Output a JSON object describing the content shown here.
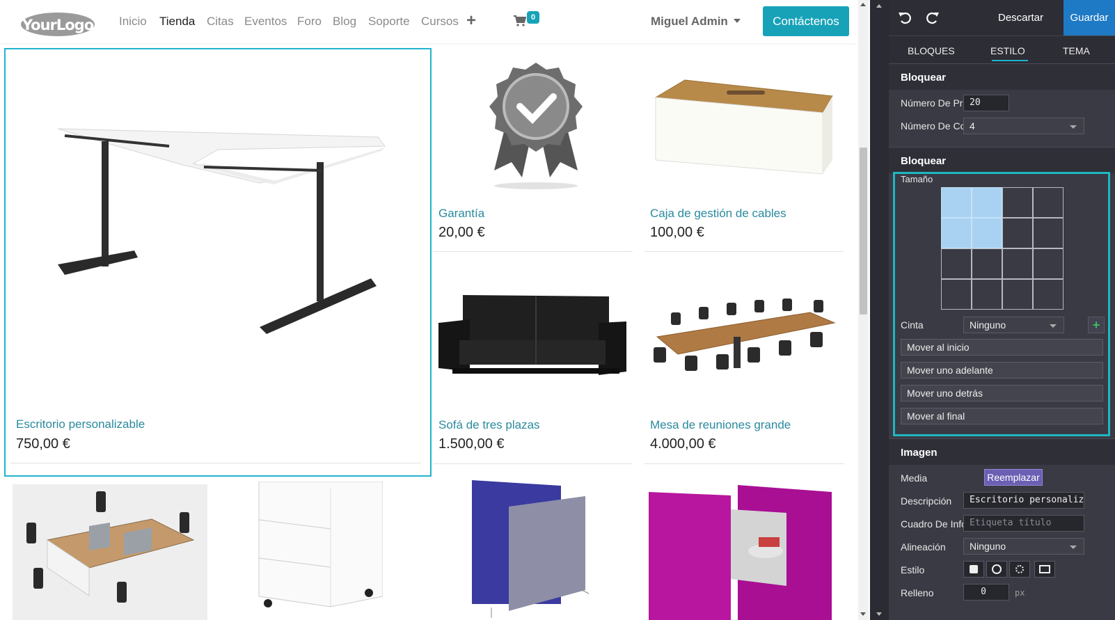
{
  "navbar": {
    "logo_text": "YourLogo",
    "links": [
      "Inicio",
      "Tienda",
      "Citas",
      "Eventos",
      "Foro",
      "Blog",
      "Soporte",
      "Cursos"
    ],
    "active_link": "Tienda",
    "cart_count": "0",
    "user_name": "Miguel Admin",
    "contact_label": "Contáctenos"
  },
  "products": [
    {
      "name": "Escritorio personalizable",
      "price": "750,00 €",
      "image": "desk"
    },
    {
      "name": "Garantía",
      "price": "20,00 €",
      "image": "warranty-badge"
    },
    {
      "name": "Caja de gestión de cables",
      "price": "100,00 €",
      "image": "cable-box"
    },
    {
      "name": "Sofá de tres plazas",
      "price": "1.500,00 €",
      "image": "sofa"
    },
    {
      "name": "Mesa de reuniones grande",
      "price": "4.000,00 €",
      "image": "conference-table"
    },
    {
      "name": "",
      "price": "",
      "image": "office-workstations"
    },
    {
      "name": "",
      "price": "",
      "image": "drawer-cabinet"
    },
    {
      "name": "",
      "price": "",
      "image": "partition-panels"
    },
    {
      "name": "",
      "price": "",
      "image": "pink-booth"
    }
  ],
  "editor": {
    "discard_label": "Descartar",
    "save_label": "Guardar",
    "tabs": [
      "BLOQUES",
      "ESTILO",
      "TEMA"
    ],
    "active_tab": "ESTILO",
    "sections": {
      "block1": {
        "title": "Bloquear",
        "product_count_label": "Número De Prod...",
        "product_count_value": "20",
        "columns_label": "Número De Colu...",
        "columns_value": "4"
      },
      "block2": {
        "title": "Bloquear",
        "size_label": "Tamaño",
        "size_selected": "2x2",
        "ribbon_label": "Cinta",
        "ribbon_value": "Ninguno",
        "move_buttons": [
          "Mover al inicio",
          "Mover uno adelante",
          "Mover uno detrás",
          "Mover al final"
        ]
      },
      "image": {
        "title": "Imagen",
        "media_label": "Media",
        "replace_label": "Reemplazar",
        "description_label": "Descripción",
        "description_value": "Escritorio personaliz",
        "tooltip_label": "Cuadro De Infor...",
        "tooltip_placeholder": "Etiqueta título",
        "alignment_label": "Alineación",
        "alignment_value": "Ninguno",
        "style_label": "Estilo",
        "style_icons": [
          "square-icon",
          "circle-icon",
          "shadow-icon",
          "image-thumbnail-icon"
        ],
        "padding_label": "Relleno",
        "padding_value": "0",
        "padding_unit": "px"
      }
    },
    "colors": {
      "accent": "#21b4cc",
      "save": "#1f7ac5",
      "grid_selected": "#a9d2f2"
    }
  }
}
